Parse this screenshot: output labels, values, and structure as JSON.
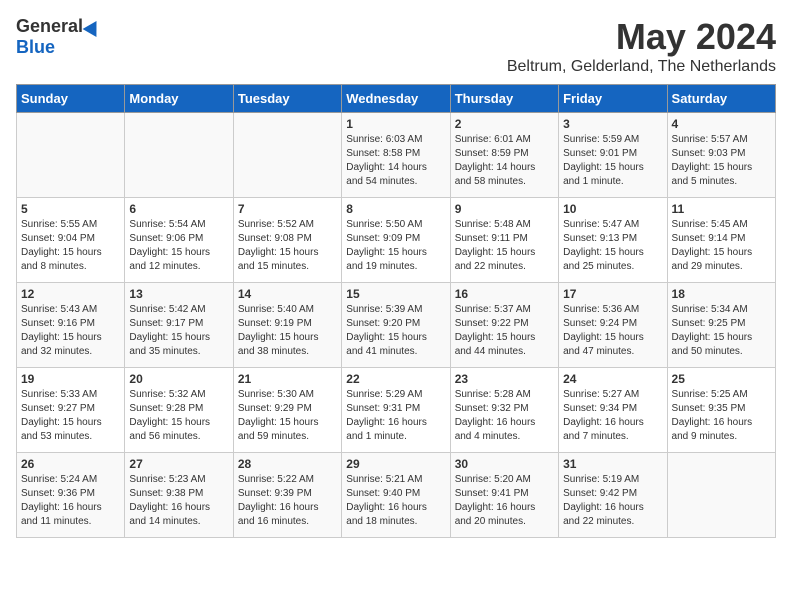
{
  "header": {
    "logo_general": "General",
    "logo_blue": "Blue",
    "main_title": "May 2024",
    "subtitle": "Beltrum, Gelderland, The Netherlands"
  },
  "days_of_week": [
    "Sunday",
    "Monday",
    "Tuesday",
    "Wednesday",
    "Thursday",
    "Friday",
    "Saturday"
  ],
  "weeks": [
    [
      {
        "day": "",
        "details": ""
      },
      {
        "day": "",
        "details": ""
      },
      {
        "day": "",
        "details": ""
      },
      {
        "day": "1",
        "details": "Sunrise: 6:03 AM\nSunset: 8:58 PM\nDaylight: 14 hours\nand 54 minutes."
      },
      {
        "day": "2",
        "details": "Sunrise: 6:01 AM\nSunset: 8:59 PM\nDaylight: 14 hours\nand 58 minutes."
      },
      {
        "day": "3",
        "details": "Sunrise: 5:59 AM\nSunset: 9:01 PM\nDaylight: 15 hours\nand 1 minute."
      },
      {
        "day": "4",
        "details": "Sunrise: 5:57 AM\nSunset: 9:03 PM\nDaylight: 15 hours\nand 5 minutes."
      }
    ],
    [
      {
        "day": "5",
        "details": "Sunrise: 5:55 AM\nSunset: 9:04 PM\nDaylight: 15 hours\nand 8 minutes."
      },
      {
        "day": "6",
        "details": "Sunrise: 5:54 AM\nSunset: 9:06 PM\nDaylight: 15 hours\nand 12 minutes."
      },
      {
        "day": "7",
        "details": "Sunrise: 5:52 AM\nSunset: 9:08 PM\nDaylight: 15 hours\nand 15 minutes."
      },
      {
        "day": "8",
        "details": "Sunrise: 5:50 AM\nSunset: 9:09 PM\nDaylight: 15 hours\nand 19 minutes."
      },
      {
        "day": "9",
        "details": "Sunrise: 5:48 AM\nSunset: 9:11 PM\nDaylight: 15 hours\nand 22 minutes."
      },
      {
        "day": "10",
        "details": "Sunrise: 5:47 AM\nSunset: 9:13 PM\nDaylight: 15 hours\nand 25 minutes."
      },
      {
        "day": "11",
        "details": "Sunrise: 5:45 AM\nSunset: 9:14 PM\nDaylight: 15 hours\nand 29 minutes."
      }
    ],
    [
      {
        "day": "12",
        "details": "Sunrise: 5:43 AM\nSunset: 9:16 PM\nDaylight: 15 hours\nand 32 minutes."
      },
      {
        "day": "13",
        "details": "Sunrise: 5:42 AM\nSunset: 9:17 PM\nDaylight: 15 hours\nand 35 minutes."
      },
      {
        "day": "14",
        "details": "Sunrise: 5:40 AM\nSunset: 9:19 PM\nDaylight: 15 hours\nand 38 minutes."
      },
      {
        "day": "15",
        "details": "Sunrise: 5:39 AM\nSunset: 9:20 PM\nDaylight: 15 hours\nand 41 minutes."
      },
      {
        "day": "16",
        "details": "Sunrise: 5:37 AM\nSunset: 9:22 PM\nDaylight: 15 hours\nand 44 minutes."
      },
      {
        "day": "17",
        "details": "Sunrise: 5:36 AM\nSunset: 9:24 PM\nDaylight: 15 hours\nand 47 minutes."
      },
      {
        "day": "18",
        "details": "Sunrise: 5:34 AM\nSunset: 9:25 PM\nDaylight: 15 hours\nand 50 minutes."
      }
    ],
    [
      {
        "day": "19",
        "details": "Sunrise: 5:33 AM\nSunset: 9:27 PM\nDaylight: 15 hours\nand 53 minutes."
      },
      {
        "day": "20",
        "details": "Sunrise: 5:32 AM\nSunset: 9:28 PM\nDaylight: 15 hours\nand 56 minutes."
      },
      {
        "day": "21",
        "details": "Sunrise: 5:30 AM\nSunset: 9:29 PM\nDaylight: 15 hours\nand 59 minutes."
      },
      {
        "day": "22",
        "details": "Sunrise: 5:29 AM\nSunset: 9:31 PM\nDaylight: 16 hours\nand 1 minute."
      },
      {
        "day": "23",
        "details": "Sunrise: 5:28 AM\nSunset: 9:32 PM\nDaylight: 16 hours\nand 4 minutes."
      },
      {
        "day": "24",
        "details": "Sunrise: 5:27 AM\nSunset: 9:34 PM\nDaylight: 16 hours\nand 7 minutes."
      },
      {
        "day": "25",
        "details": "Sunrise: 5:25 AM\nSunset: 9:35 PM\nDaylight: 16 hours\nand 9 minutes."
      }
    ],
    [
      {
        "day": "26",
        "details": "Sunrise: 5:24 AM\nSunset: 9:36 PM\nDaylight: 16 hours\nand 11 minutes."
      },
      {
        "day": "27",
        "details": "Sunrise: 5:23 AM\nSunset: 9:38 PM\nDaylight: 16 hours\nand 14 minutes."
      },
      {
        "day": "28",
        "details": "Sunrise: 5:22 AM\nSunset: 9:39 PM\nDaylight: 16 hours\nand 16 minutes."
      },
      {
        "day": "29",
        "details": "Sunrise: 5:21 AM\nSunset: 9:40 PM\nDaylight: 16 hours\nand 18 minutes."
      },
      {
        "day": "30",
        "details": "Sunrise: 5:20 AM\nSunset: 9:41 PM\nDaylight: 16 hours\nand 20 minutes."
      },
      {
        "day": "31",
        "details": "Sunrise: 5:19 AM\nSunset: 9:42 PM\nDaylight: 16 hours\nand 22 minutes."
      },
      {
        "day": "",
        "details": ""
      }
    ]
  ]
}
